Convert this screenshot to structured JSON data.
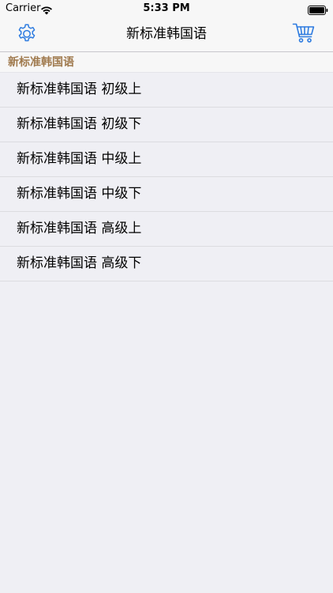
{
  "status_bar": {
    "carrier": "Carrier",
    "time": "5:33 PM",
    "wifi_icon": "wifi-icon",
    "battery_icon": "battery-icon"
  },
  "nav": {
    "title": "新标准韩国语",
    "left_icon": "gear-icon",
    "right_icon": "cart-icon",
    "accent_color": "#2f7ce0"
  },
  "section": {
    "header": "新标准韩国语",
    "header_color": "#a07a4e"
  },
  "items": [
    {
      "label": "新标准韩国语 初级上"
    },
    {
      "label": "新标准韩国语 初级下"
    },
    {
      "label": "新标准韩国语 中级上"
    },
    {
      "label": "新标准韩国语 中级下"
    },
    {
      "label": "新标准韩国语 高级上"
    },
    {
      "label": "新标准韩国语 高级下"
    }
  ],
  "colors": {
    "background": "#efeff4",
    "bar_background": "#f7f7f7"
  }
}
